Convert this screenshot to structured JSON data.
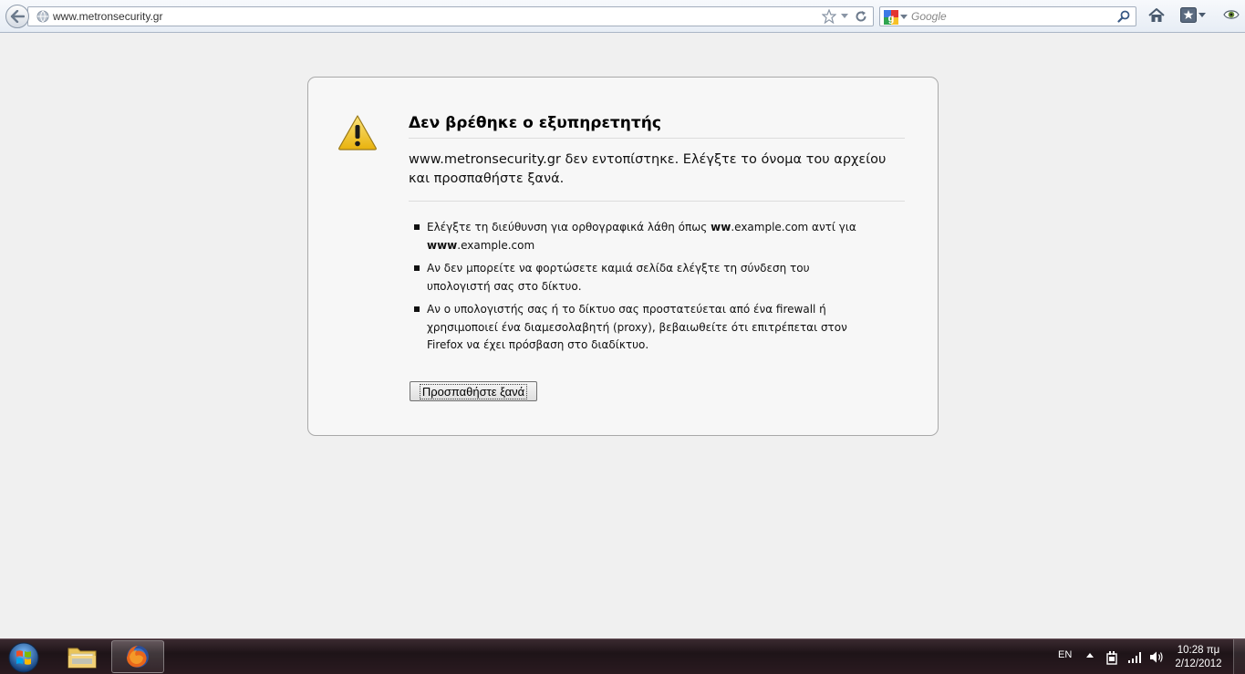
{
  "browser": {
    "url": "www.metronsecurity.gr",
    "search_engine_icon": "google-icon",
    "search_placeholder": "Google"
  },
  "error": {
    "title": "Δεν βρέθηκε ο εξυπηρετητής",
    "description": "www.metronsecurity.gr δεν εντοπίστηκε. Ελέγξτε το όνομα του αρχείου και προσπαθήστε ξανά.",
    "suggestions": [
      {
        "part1": "Ελέγξτε τη διεύθυνση για ορθογραφικά λάθη όπως ",
        "bold1": "ww",
        "part2": ".example.com αντί για ",
        "bold2": "www",
        "part3": ".example.com"
      },
      {
        "text": "Αν δεν μπορείτε να φορτώσετε καμιά σελίδα ελέγξτε τη σύνδεση του υπολογιστή σας στο δίκτυο."
      },
      {
        "text": "Αν ο υπολογιστής σας ή το δίκτυο σας προστατεύεται από ένα firewall ή χρησιμοποιεί ένα διαμεσολαβητή (proxy), βεβαιωθείτε ότι επιτρέπεται στον Firefox να έχει πρόσβαση στο διαδίκτυο."
      }
    ],
    "try_again_label": "Προσπαθήστε ξανά"
  },
  "taskbar": {
    "language": "EN",
    "time": "10:28 πμ",
    "date": "2/12/2012"
  },
  "colors": {
    "warning_yellow": "#f4c72a",
    "taskbar_dark": "#1e1418",
    "page_background": "#f0f0f0"
  }
}
